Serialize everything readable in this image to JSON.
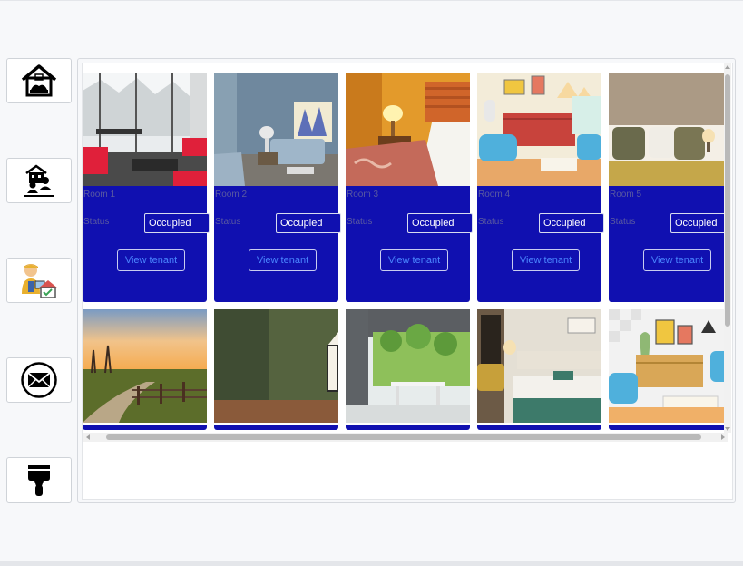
{
  "sidebar": {
    "items": [
      {
        "name": "home-dashboard",
        "icon": "house-icon"
      },
      {
        "name": "tenants",
        "icon": "tenant-building-icon"
      },
      {
        "name": "landlord",
        "icon": "landlord-icon"
      },
      {
        "name": "messages",
        "icon": "envelope-icon"
      },
      {
        "name": "maintenance",
        "icon": "paint-brush-icon"
      }
    ]
  },
  "rooms": [
    {
      "label": "Room 1",
      "status_label": "Status",
      "status": "Occupied",
      "button": "View tenant",
      "photo": "living-room-snowy-view"
    },
    {
      "label": "Room 2",
      "status_label": "Status",
      "status": "Occupied",
      "button": "View tenant",
      "photo": "blue-living-room"
    },
    {
      "label": "Room 3",
      "status_label": "Status",
      "status": "Occupied",
      "button": "View tenant",
      "photo": "orange-hotel-bedroom"
    },
    {
      "label": "Room 4",
      "status_label": "Status",
      "status": "Occupied",
      "button": "View tenant",
      "photo": "cartoon-living-room"
    },
    {
      "label": "Room 5",
      "status_label": "Status",
      "status": "Occupied",
      "button": "View tenant",
      "photo": "beige-bedroom"
    },
    {
      "label": "",
      "status_label": "",
      "status": "",
      "button": "",
      "photo": "sunset-field-path"
    },
    {
      "label": "",
      "status_label": "",
      "status": "",
      "button": "",
      "photo": "empty-green-room"
    },
    {
      "label": "",
      "status_label": "",
      "status": "",
      "button": "",
      "photo": "greenery-dining-room"
    },
    {
      "label": "",
      "status_label": "",
      "status": "",
      "button": "",
      "photo": "teal-bedroom"
    },
    {
      "label": "",
      "status_label": "",
      "status": "",
      "button": "",
      "photo": "cartoon-sitting-room"
    }
  ],
  "colors": {
    "card_info_bg": "#1010b0",
    "button_text": "#4a86ff",
    "label_text": "#5a5aa0",
    "page_bg": "#f7f8fa"
  }
}
